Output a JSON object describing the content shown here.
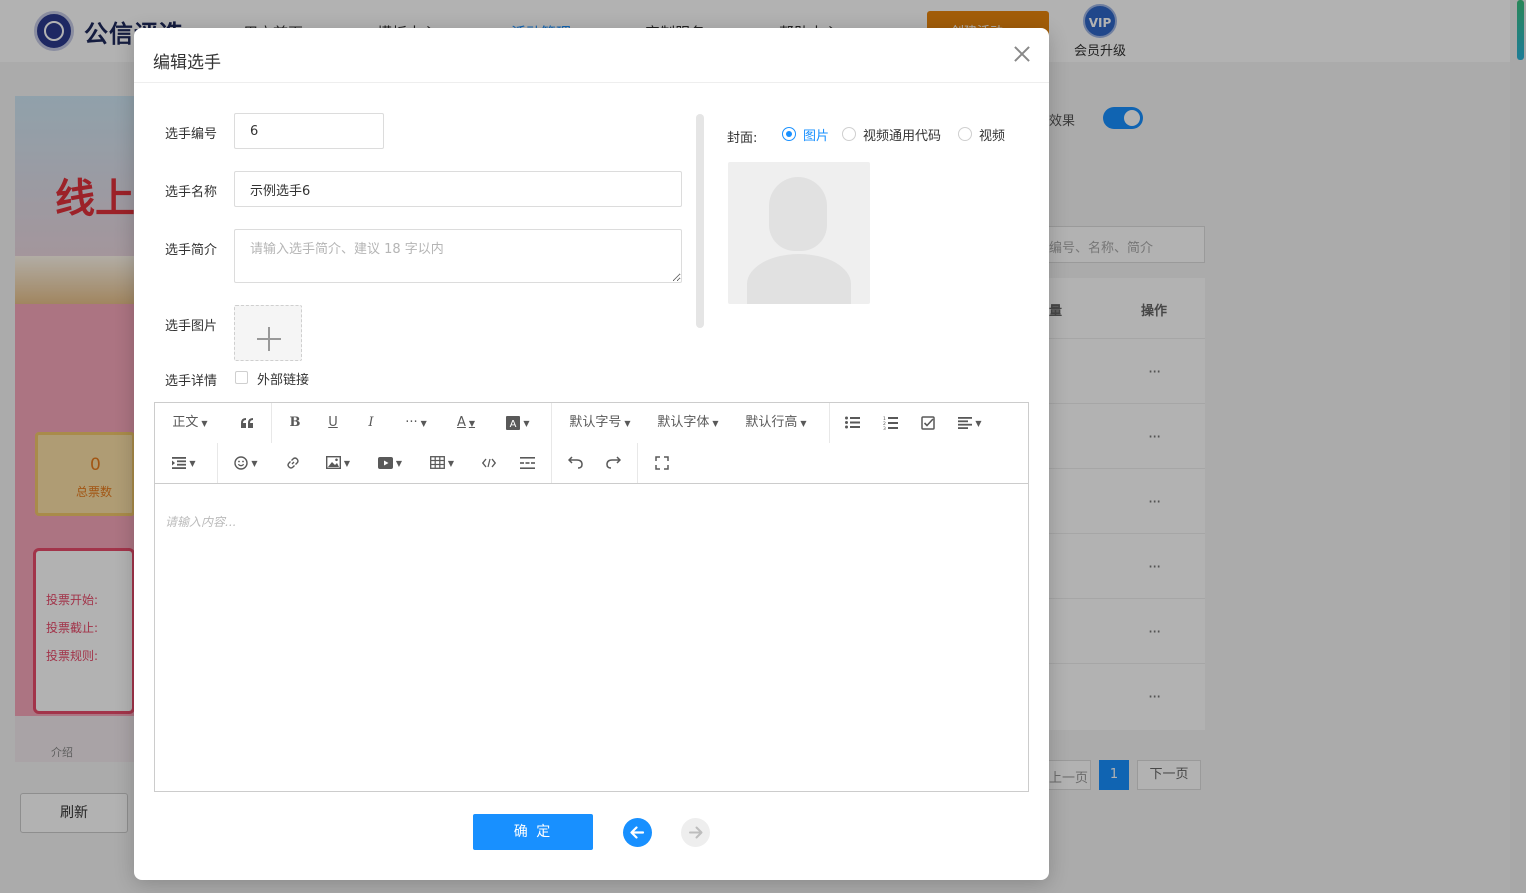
{
  "background": {
    "logo_text": "公信评选",
    "nav_items": [
      "用户首页",
      "模板中心",
      "活动管理",
      "定制服务",
      "帮助中心"
    ],
    "vip_button": "创建活动",
    "vip_badge": "VIP",
    "vip_label": "会员升级",
    "poster_title": "线上",
    "count_value": "0",
    "count_label": "总票数",
    "info_lines": [
      "投票开始:",
      "投票截止:",
      "投票规则:"
    ],
    "poster_nav": "介绍",
    "refresh_label": "刷新",
    "effect_label": "效果",
    "search_placeholder": "编号、名称、简介",
    "th_qty": "量",
    "th_op": "操作",
    "row_action": "···",
    "pager_prev": "上一页",
    "pager_current": "1",
    "pager_next": "下一页",
    "accent_color": "#1890ff"
  },
  "modal": {
    "title": "编辑选手",
    "fields": {
      "number_label": "选手编号",
      "number_value": "6",
      "name_label": "选手名称",
      "name_value": "示例选手6",
      "intro_label": "选手简介",
      "intro_placeholder": "请输入选手简介、建议 18 字以内",
      "image_label": "选手图片",
      "detail_label": "选手详情",
      "external_link_label": "外部链接"
    },
    "cover": {
      "label": "封面:",
      "options": [
        "图片",
        "视频通用代码",
        "视频"
      ],
      "selected": "图片"
    },
    "editor": {
      "toolbar": {
        "paragraph": "正文",
        "font_size": "默认字号",
        "font_family": "默认字体",
        "line_height": "默认行高"
      },
      "placeholder": "请输入内容..."
    },
    "confirm_label": "确 定"
  }
}
